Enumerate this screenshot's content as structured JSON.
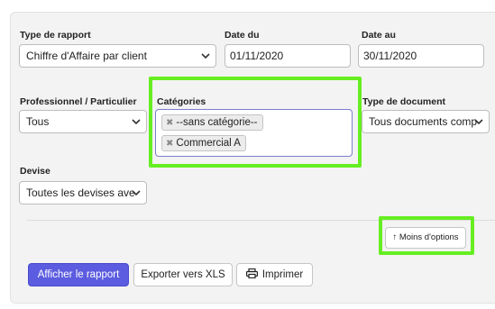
{
  "report_type": {
    "label": "Type de rapport",
    "value": "Chiffre d'Affaire par client"
  },
  "date_from": {
    "label": "Date du",
    "value": "01/11/2020"
  },
  "date_to": {
    "label": "Date au",
    "value": "30/11/2020"
  },
  "client_kind": {
    "label": "Professionnel / Particulier",
    "value": "Tous"
  },
  "categories": {
    "label": "Catégories",
    "tags": [
      "--sans catégorie--",
      "Commercial A"
    ],
    "remove_glyph": "✖"
  },
  "document_type": {
    "label": "Type de document",
    "value": "Tous documents comp"
  },
  "currency": {
    "label": "Devise",
    "value": "Toutes les devises ave"
  },
  "less_options": {
    "label": "Moins d'options",
    "arrow": "↑"
  },
  "actions": {
    "show_report": "Afficher le rapport",
    "export_xls": "Exporter vers XLS",
    "print": "Imprimer"
  },
  "colors": {
    "highlight": "#66ee22",
    "primary": "#5c5ce0"
  }
}
